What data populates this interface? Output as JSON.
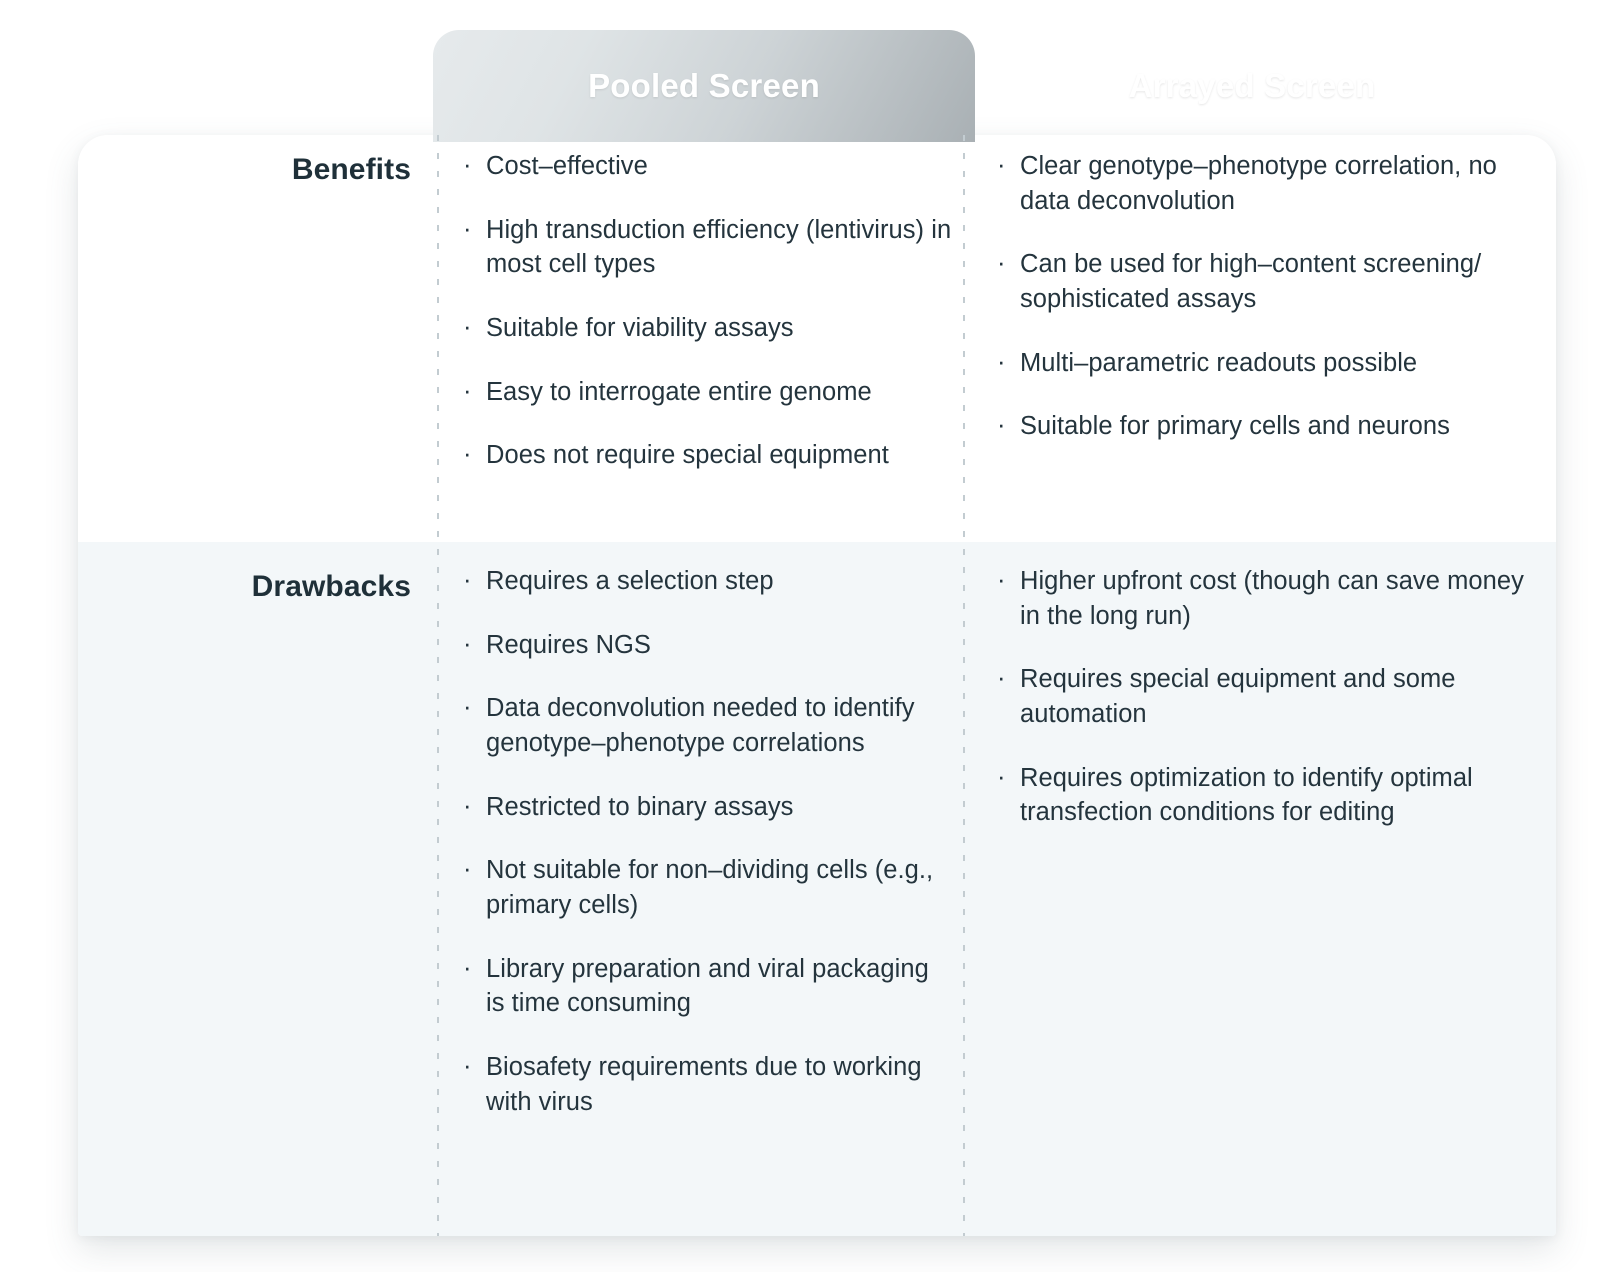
{
  "header": {
    "tabs": [
      {
        "label": "Pooled Screen",
        "accent": "#c6cdd0"
      },
      {
        "label": "Arrayed Screen",
        "accent": "#54cc62"
      }
    ]
  },
  "table": {
    "row_labels": {
      "benefits": "Benefits",
      "drawbacks": "Drawbacks"
    },
    "benefits": {
      "pooled": [
        "Cost–effective",
        "High transduction efficiency (lentivirus) in most cell types",
        "Suitable for viability assays",
        "Easy to interrogate entire genome",
        "Does not require special equipment"
      ],
      "arrayed": [
        "Clear genotype–phenotype correlation, no data deconvolution",
        "Can be used for high–content screening/ sophisticated assays",
        "Multi–parametric readouts possible",
        "Suitable for primary cells and neurons"
      ]
    },
    "drawbacks": {
      "pooled": [
        "Requires a selection step",
        "Requires NGS",
        "Data deconvolution needed to identify genotype–phenotype correlations",
        "Restricted to binary assays",
        "Not suitable for non–dividing cells (e.g., primary cells)",
        "Library preparation and viral packaging is time consuming",
        "Biosafety requirements due to working with virus"
      ],
      "arrayed": [
        "Higher upfront cost (though can save money in the long run)",
        "Requires special equipment and some automation",
        "Requires optimization to identify optimal transfection conditions for editing"
      ]
    }
  },
  "style_tokens": {
    "text_color": "#24343d",
    "label_color": "#1f3039",
    "drawbacks_row_bg": "#f3f7f9",
    "benefits_row_bg": "#ffffff",
    "divider_color": "#c3ccd1",
    "page_bg": "#ffffff"
  }
}
